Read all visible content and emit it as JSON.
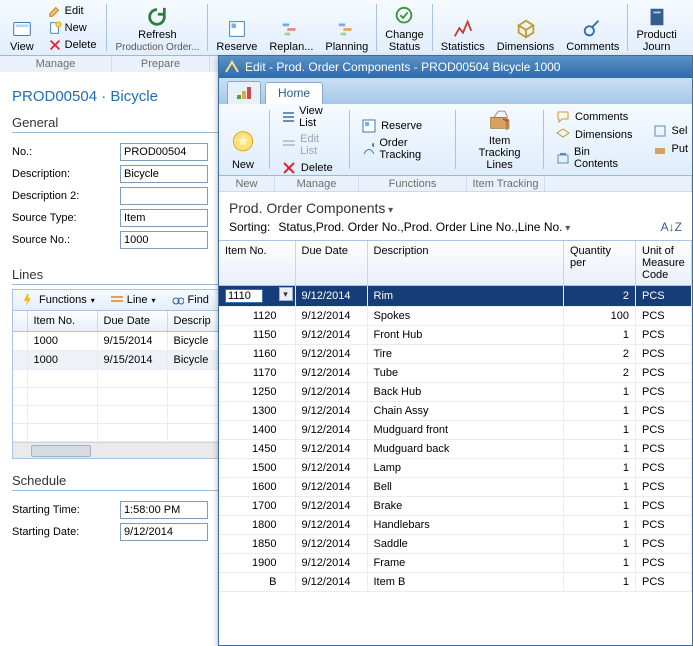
{
  "main": {
    "ribbon": {
      "view": "View",
      "edit": "Edit",
      "new": "New",
      "delete": "Delete",
      "refresh": "Refresh",
      "refresh_sub": "Production Order...",
      "reserve": "Reserve",
      "replan": "Replan...",
      "planning": "Planning",
      "change_status": "Change\nStatus",
      "statistics": "Statistics",
      "dimensions": "Dimensions",
      "comments": "Comments",
      "product": "Producti\nJourn"
    },
    "groups": {
      "manage": "Manage",
      "prepare": "Prepare"
    },
    "title_id": "PROD00504",
    "title_sep": " · ",
    "title_name": "Bicycle",
    "panels": {
      "general": "General",
      "lines": "Lines",
      "schedule": "Schedule"
    },
    "fields": {
      "no_lbl": "No.:",
      "no_val": "PROD00504",
      "desc_lbl": "Description:",
      "desc_val": "Bicycle",
      "desc2_lbl": "Description 2:",
      "desc2_val": "",
      "srctype_lbl": "Source Type:",
      "srctype_val": "Item",
      "srcno_lbl": "Source No.:",
      "srcno_val": "1000"
    },
    "lines_toolbar": {
      "functions": "Functions",
      "line": "Line",
      "find": "Find"
    },
    "lines_cols": {
      "itemno": "Item No.",
      "due": "Due Date",
      "desc": "Descrip"
    },
    "lines_rows": [
      {
        "itemno": "1000",
        "due": "9/15/2014",
        "desc": "Bicycle"
      }
    ],
    "schedule": {
      "start_time_lbl": "Starting Time:",
      "start_time_val": "1:58:00 PM",
      "start_date_lbl": "Starting Date:",
      "start_date_val": "9/12/2014"
    }
  },
  "overlay": {
    "title": "Edit - Prod. Order Components - PROD00504 Bicycle 1000",
    "home_tab": "Home",
    "ribbon": {
      "new": "New",
      "view_list": "View List",
      "edit_list": "Edit List",
      "delete": "Delete",
      "reserve": "Reserve",
      "order_tracking": "Order Tracking",
      "item_tracking": "Item\nTracking Lines",
      "comments": "Comments",
      "dimensions": "Dimensions",
      "bin_contents": "Bin Contents",
      "sel": "Sel",
      "put": "Put"
    },
    "groups": {
      "new": "New",
      "manage": "Manage",
      "functions": "Functions",
      "itrack": "Item Tracking"
    },
    "section": "Prod. Order Components",
    "sorting_lbl": "Sorting:",
    "sorting_val": "Status,Prod. Order No.,Prod. Order Line No.,Line No.",
    "cols": {
      "itemno": "Item No.",
      "due": "Due Date",
      "desc": "Description",
      "qty": "Quantity per",
      "uom": "Unit of\nMeasure\nCode"
    },
    "rows": [
      {
        "itemno": "1110",
        "due": "9/12/2014",
        "desc": "Rim",
        "qty": "2",
        "uom": "PCS"
      },
      {
        "itemno": "1120",
        "due": "9/12/2014",
        "desc": "Spokes",
        "qty": "100",
        "uom": "PCS"
      },
      {
        "itemno": "1150",
        "due": "9/12/2014",
        "desc": "Front Hub",
        "qty": "1",
        "uom": "PCS"
      },
      {
        "itemno": "1160",
        "due": "9/12/2014",
        "desc": "Tire",
        "qty": "2",
        "uom": "PCS"
      },
      {
        "itemno": "1170",
        "due": "9/12/2014",
        "desc": "Tube",
        "qty": "2",
        "uom": "PCS"
      },
      {
        "itemno": "1250",
        "due": "9/12/2014",
        "desc": "Back Hub",
        "qty": "1",
        "uom": "PCS"
      },
      {
        "itemno": "1300",
        "due": "9/12/2014",
        "desc": "Chain Assy",
        "qty": "1",
        "uom": "PCS"
      },
      {
        "itemno": "1400",
        "due": "9/12/2014",
        "desc": "Mudguard front",
        "qty": "1",
        "uom": "PCS"
      },
      {
        "itemno": "1450",
        "due": "9/12/2014",
        "desc": "Mudguard back",
        "qty": "1",
        "uom": "PCS"
      },
      {
        "itemno": "1500",
        "due": "9/12/2014",
        "desc": "Lamp",
        "qty": "1",
        "uom": "PCS"
      },
      {
        "itemno": "1600",
        "due": "9/12/2014",
        "desc": "Bell",
        "qty": "1",
        "uom": "PCS"
      },
      {
        "itemno": "1700",
        "due": "9/12/2014",
        "desc": "Brake",
        "qty": "1",
        "uom": "PCS"
      },
      {
        "itemno": "1800",
        "due": "9/12/2014",
        "desc": "Handlebars",
        "qty": "1",
        "uom": "PCS"
      },
      {
        "itemno": "1850",
        "due": "9/12/2014",
        "desc": "Saddle",
        "qty": "1",
        "uom": "PCS"
      },
      {
        "itemno": "1900",
        "due": "9/12/2014",
        "desc": "Frame",
        "qty": "1",
        "uom": "PCS"
      },
      {
        "itemno": "B",
        "due": "9/12/2014",
        "desc": "Item B",
        "qty": "1",
        "uom": "PCS"
      }
    ]
  }
}
